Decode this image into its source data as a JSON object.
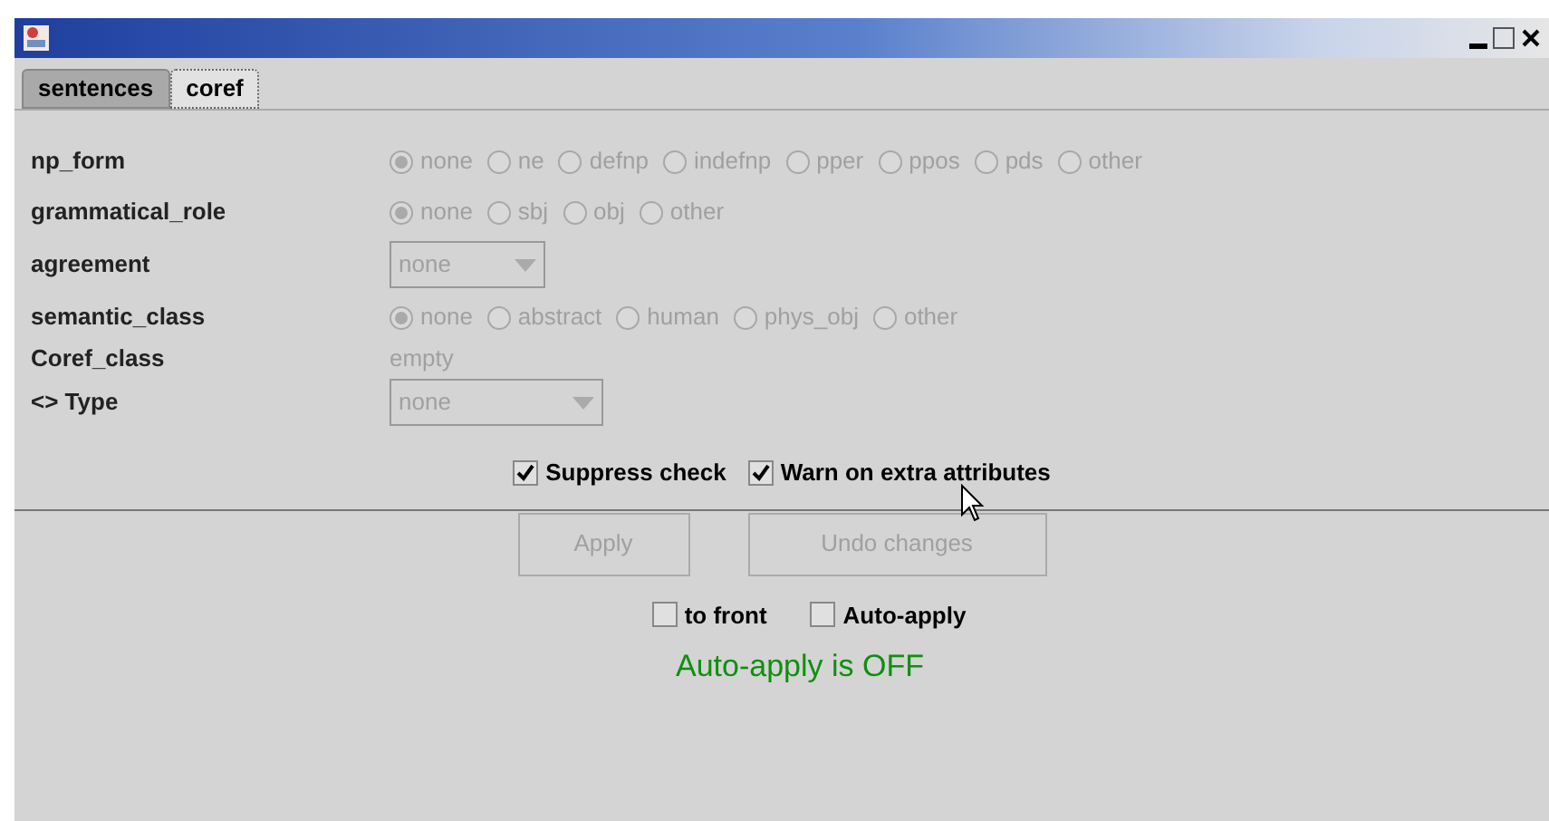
{
  "tabs": [
    {
      "label": "sentences",
      "selected": false
    },
    {
      "label": "coref",
      "selected": true
    }
  ],
  "attributes": [
    {
      "label": "np_form",
      "kind": "radio",
      "disabled": true,
      "options": [
        {
          "label": "none",
          "selected": true
        },
        {
          "label": "ne",
          "selected": false
        },
        {
          "label": "defnp",
          "selected": false
        },
        {
          "label": "indefnp",
          "selected": false
        },
        {
          "label": "pper",
          "selected": false
        },
        {
          "label": "ppos",
          "selected": false
        },
        {
          "label": "pds",
          "selected": false
        },
        {
          "label": "other",
          "selected": false
        }
      ]
    },
    {
      "label": "grammatical_role",
      "kind": "radio",
      "disabled": true,
      "options": [
        {
          "label": "none",
          "selected": true
        },
        {
          "label": "sbj",
          "selected": false
        },
        {
          "label": "obj",
          "selected": false
        },
        {
          "label": "other",
          "selected": false
        }
      ]
    },
    {
      "label": "agreement",
      "kind": "dropdown",
      "disabled": true,
      "value": "none"
    },
    {
      "label": "semantic_class",
      "kind": "radio",
      "disabled": true,
      "options": [
        {
          "label": "none",
          "selected": true
        },
        {
          "label": "abstract",
          "selected": false
        },
        {
          "label": "human",
          "selected": false
        },
        {
          "label": "phys_obj",
          "selected": false
        },
        {
          "label": "other",
          "selected": false
        }
      ]
    },
    {
      "label": "Coref_class",
      "kind": "text",
      "disabled": true,
      "value": "empty"
    },
    {
      "label": "<> Type",
      "kind": "dropdown",
      "disabled": true,
      "value": "none"
    }
  ],
  "options": [
    {
      "label": "Suppress check",
      "checked": true
    },
    {
      "label": "Warn on extra attributes",
      "checked": true
    }
  ],
  "buttons": [
    {
      "label": "Apply",
      "disabled": true
    },
    {
      "label": "Undo changes",
      "disabled": true
    }
  ],
  "window_options": [
    {
      "label": "to front",
      "checked": false
    },
    {
      "label": "Auto-apply",
      "checked": false
    }
  ],
  "status": "Auto-apply is OFF"
}
